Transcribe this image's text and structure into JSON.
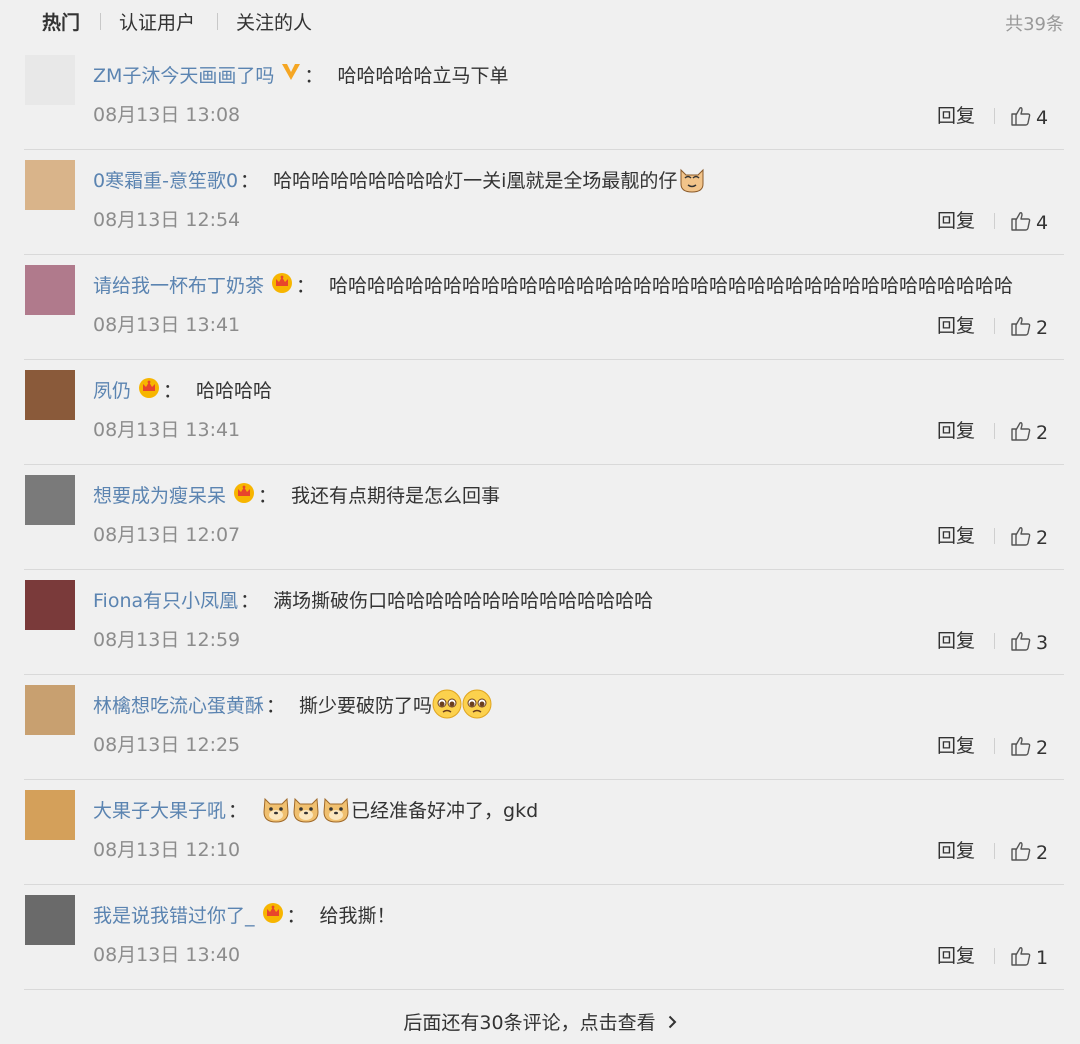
{
  "tabs": {
    "hot": "热门",
    "verified": "认证用户",
    "following": "关注的人",
    "count": "共39条"
  },
  "comments": [
    {
      "user": "ZM子沐今天画画了吗",
      "badge": "vip-v-icon",
      "text": "哈哈哈哈哈立马下单",
      "time": "08月13日 13:08",
      "reply": "回复",
      "likes": "4",
      "avatar_color": "#e8e8e8",
      "emojis": []
    },
    {
      "user": "0寒霜重-意笙歌0",
      "badge": "",
      "text": "哈哈哈哈哈哈哈哈哈灯一关i凰就是全场最靓的仔",
      "time": "08月13日 12:54",
      "reply": "回复",
      "likes": "4",
      "avatar_color": "#d9b48a",
      "emojis": [
        "cat-emoji-icon"
      ]
    },
    {
      "user": "请给我一杯布丁奶茶",
      "badge": "crown-icon",
      "text": "哈哈哈哈哈哈哈哈哈哈哈哈哈哈哈哈哈哈哈哈哈哈哈哈哈哈哈哈哈哈哈哈哈哈哈哈",
      "time": "08月13日 13:41",
      "reply": "回复",
      "likes": "2",
      "avatar_color": "#b07a8c",
      "emojis": []
    },
    {
      "user": "夙仍",
      "badge": "crown-icon",
      "text": "哈哈哈哈",
      "time": "08月13日 13:41",
      "reply": "回复",
      "likes": "2",
      "avatar_color": "#8a5a3a",
      "emojis": []
    },
    {
      "user": "想要成为瘦呆呆",
      "badge": "crown-icon",
      "text": "我还有点期待是怎么回事",
      "time": "08月13日 12:07",
      "reply": "回复",
      "likes": "2",
      "avatar_color": "#7a7a7a",
      "emojis": []
    },
    {
      "user": "Fiona有只小凤凰",
      "badge": "",
      "text": "满场撕破伤口哈哈哈哈哈哈哈哈哈哈哈哈哈哈",
      "time": "08月13日 12:59",
      "reply": "回复",
      "likes": "3",
      "avatar_color": "#7a3a3a",
      "emojis": []
    },
    {
      "user": "林檎想吃流心蛋黄酥",
      "badge": "",
      "text": "撕少要破防了吗",
      "time": "08月13日 12:25",
      "reply": "回复",
      "likes": "2",
      "avatar_color": "#c8a070",
      "emojis": [
        "pleading-face-icon",
        "pleading-face-icon"
      ]
    },
    {
      "user": "大果子大果子吼",
      "badge": "",
      "text": "已经准备好冲了，gkd",
      "time": "08月13日 12:10",
      "reply": "回复",
      "likes": "2",
      "avatar_color": "#d4a05a",
      "emojis_before": [
        "doge-icon",
        "doge-icon",
        "doge-icon"
      ],
      "emojis": []
    },
    {
      "user": "我是说我错过你了_",
      "badge": "crown-icon",
      "text": "给我撕！",
      "time": "08月13日 13:40",
      "reply": "回复",
      "likes": "1",
      "avatar_color": "#6a6a6a",
      "emojis": []
    }
  ],
  "footer": {
    "more_label": "后面还有30条评论，点击查看"
  },
  "colors": {
    "username": "#5b84b1",
    "background": "#f0f0f0",
    "divider": "#d9d9d9",
    "time": "#8c8c8c"
  }
}
